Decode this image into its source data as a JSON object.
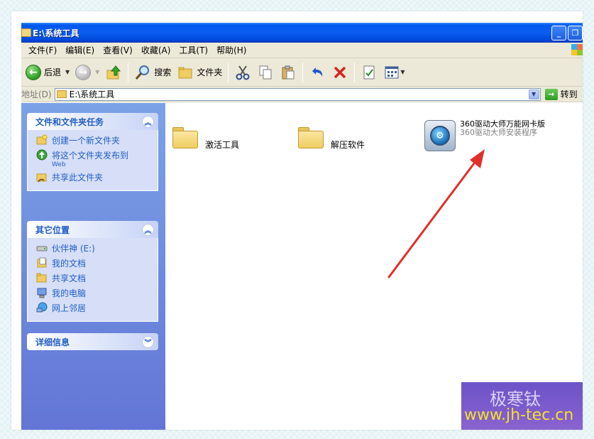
{
  "window": {
    "title": "E:\\系统工具",
    "buttons": [
      "_",
      "❐",
      "×"
    ]
  },
  "menubar": {
    "items": [
      "文件(F)",
      "编辑(E)",
      "查看(V)",
      "收藏(A)",
      "工具(T)",
      "帮助(H)"
    ]
  },
  "toolbar": {
    "back_label": "后退",
    "search_label": "搜索",
    "folders_label": "文件夹"
  },
  "address": {
    "label": "地址(D)",
    "path": "E:\\系统工具",
    "go_label": "转到"
  },
  "tasks_panel": {
    "title": "文件和文件夹任务",
    "items": [
      {
        "label": "创建一个新文件夹",
        "sub": ""
      },
      {
        "label": "将这个文件夹发布到",
        "sub": "Web"
      },
      {
        "label": "共享此文件夹",
        "sub": ""
      }
    ]
  },
  "places_panel": {
    "title": "其它位置",
    "items": [
      {
        "label": "伙伴神 (E:)"
      },
      {
        "label": "我的文档"
      },
      {
        "label": "共享文档"
      },
      {
        "label": "我的电脑"
      },
      {
        "label": "网上邻居"
      }
    ]
  },
  "details_panel": {
    "title": "详细信息"
  },
  "files": [
    {
      "name": "激活工具",
      "type": "folder"
    },
    {
      "name": "解压软件",
      "type": "folder"
    },
    {
      "name": "360驱动大师万能网卡版",
      "desc": "360驱动大师安装程序",
      "type": "app"
    }
  ],
  "watermark": {
    "name": "极寒钛",
    "url": "www.jh-tec.cn"
  },
  "colors": {
    "titlebar": "#0058ee",
    "task_link": "#215dc6",
    "arrow": "#e0302c"
  }
}
